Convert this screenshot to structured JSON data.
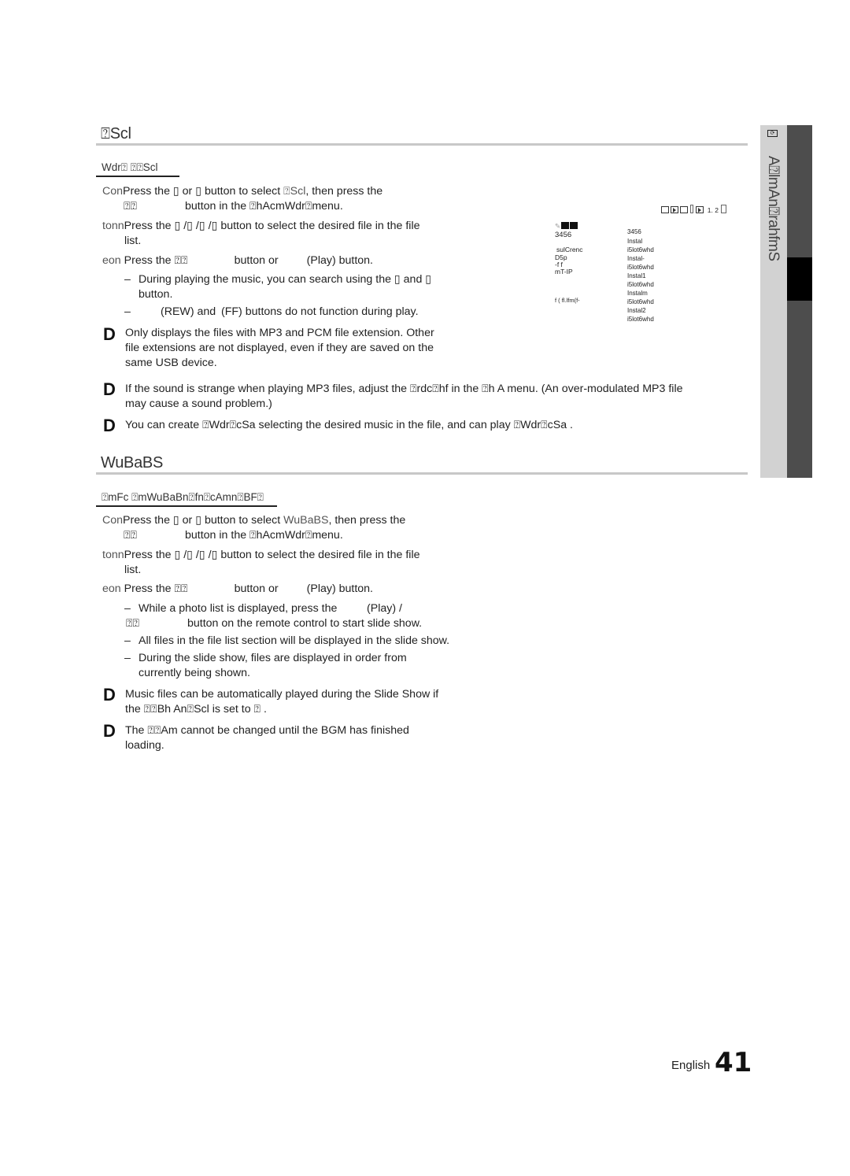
{
  "page": {
    "language": "English",
    "number": "41"
  },
  "sidebar": {
    "icon": "chapter-icon",
    "chapter_label": "A⍰lmAn⍰rahfmS"
  },
  "section1": {
    "title": "⍰Scl",
    "subtitle": "Wdr⍰ ⍰⍰Scl",
    "steps": [
      {
        "num": "Con",
        "text_a": "Press the ▯ or ▯ button to select ",
        "highlight": "⍰Scl",
        "text_b": ", then press the",
        "line2_key": "⍰⍰",
        "line2_text": "button in the ⍰hAcmWdr⍰menu."
      },
      {
        "num": "tonn",
        "text": "Press the ▯ /▯ /▯ /▯  button to select the desired file in the file",
        "line2": "list."
      },
      {
        "num": "eon",
        "text_a": "Press the ⍰⍰",
        "text_b": "button or",
        "text_c": "(Play) button."
      }
    ],
    "dash_items": [
      {
        "line1": "During playing the music, you can search using the ▯  and ▯",
        "line2": "button."
      },
      {
        "line1a": "(REW) and",
        "line1b": "(FF) buttons do not function during play."
      }
    ],
    "notes": [
      {
        "lines": [
          "Only displays the files with MP3 and PCM file extension. Other",
          "file extensions are not displayed, even if they are saved on the",
          "same USB device."
        ]
      },
      {
        "lines": [
          "If the sound is strange when playing MP3 files, adjust the ⍰rdc⍰hf in the ⍰h A menu. (An over-modulated MP3 file",
          "may cause a sound problem.)"
        ]
      },
      {
        "lines": [
          "You can create ⍰Wdr⍰cSa selecting the desired music in the file, and can play ⍰Wdr⍰cSa    ."
        ]
      }
    ]
  },
  "illustration": {
    "status_bar": "1. 2",
    "left_header": "3456",
    "left_lines": [
      "sulCrenc",
      "D5p",
      "-f f",
      "mT-IP"
    ],
    "left_footer": "f ( fl.lfm(f-",
    "right_header": "3456",
    "files": [
      {
        "name": "Instal",
        "info": "i5lot6whd"
      },
      {
        "name": "Instal-",
        "info": "i5lot6whd"
      },
      {
        "name": "Instal1",
        "info": "i5lot6whd"
      },
      {
        "name": "Instalm",
        "info": "i5lot6whd"
      },
      {
        "name": "Instal2",
        "info": "i5lot6whd"
      }
    ]
  },
  "section2": {
    "title": "WuBaBS",
    "subtitle": "⍰mFc ⍰mWuBaBn⍰fn⍰cAmn⍰BF⍰",
    "steps": [
      {
        "num": "Con",
        "text_a": "Press the ▯ or ▯ button to select ",
        "highlight": "WuBaBS",
        "text_b": ", then press the",
        "line2_key": "⍰⍰",
        "line2_text": "button in the ⍰hAcmWdr⍰menu."
      },
      {
        "num": "tonn",
        "text": "Press the ▯ /▯ /▯ /▯  button to select the desired file in the file",
        "line2": "list."
      },
      {
        "num": "eon",
        "text_a": "Press the ⍰⍰",
        "text_b": "button or",
        "text_c": "(Play) button."
      }
    ],
    "dash_items": [
      {
        "line1a": "While a photo list is displayed, press the",
        "line1b": "(Play) /",
        "line2_key": "⍰⍰",
        "line2_text": "button on the remote control to start slide show."
      },
      {
        "line1": "All files in the file list section will be displayed in the slide show."
      },
      {
        "line1": "During the slide show, files are displayed in order from",
        "line2": "currently being shown."
      }
    ],
    "notes": [
      {
        "lines": [
          "Music files can be automatically played during the Slide Show if",
          "the ⍰⍰Bh An⍰Scl is set to ⍰              ."
        ]
      },
      {
        "lines": [
          "The ⍰⍰Am cannot be changed until the BGM has finished",
          "loading."
        ]
      }
    ]
  }
}
